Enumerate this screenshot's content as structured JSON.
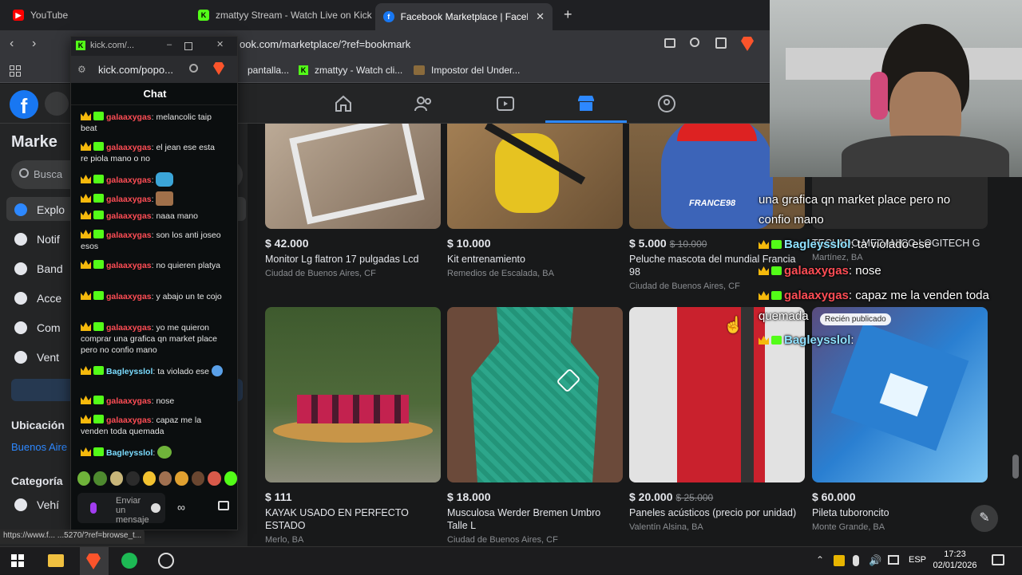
{
  "browser": {
    "tabs": [
      {
        "label": "YouTube",
        "icon": "youtube-icon"
      },
      {
        "label": "zmattyy Stream - Watch Live on Kick",
        "icon": "kick-icon"
      },
      {
        "label": "Facebook Marketplace | Faceboo",
        "icon": "facebook-icon",
        "active": true
      }
    ],
    "new_tab": "+",
    "close": "✕",
    "url": "ook.com/marketplace/?ref=bookmark",
    "bookmarks": [
      "pantalla...",
      "zmattyy - Watch cli...",
      "Impostor del Under..."
    ],
    "status_url": "https://www.f... ...5270/?ref=browse_t..."
  },
  "facebook": {
    "sidebar_title": "Marke",
    "search_placeholder": "Busca",
    "sidebar_items": [
      "Explo",
      "Notif",
      "Band",
      "Acce",
      "Com",
      "Vent"
    ],
    "location_heading": "Ubicación",
    "location_value": "Buenos Aire",
    "categories_heading": "Categoría",
    "category_first": "Vehí"
  },
  "listings": [
    {
      "price": "$ 42.000",
      "old_price": "",
      "title": "Monitor Lg flatron 17 pulgadas Lcd",
      "location": "Ciudad de Buenos Aires, CF",
      "colors": [
        "#b8a694",
        "#7e6a58"
      ]
    },
    {
      "price": "$ 10.000",
      "old_price": "",
      "title": "Kit entrenamiento",
      "location": "Remedios de Escalada, BA",
      "colors": [
        "#9a7a52",
        "#2b2b2b"
      ]
    },
    {
      "price": "$ 5.000",
      "old_price": "$ 10.000",
      "title": "Peluche mascota del mundial Francia 98",
      "location": "Ciudad de Buenos Aires, CF",
      "colors": [
        "#3c64b8",
        "#8d6f4a"
      ]
    },
    {
      "price": "",
      "old_price": "",
      "title": "TECLADO MECANICO LOGITECH G",
      "location": "Martínez, BA",
      "colors": [
        "#555",
        "#333"
      ]
    },
    {
      "price": "$ 111",
      "old_price": "",
      "title": "KAYAK USADO EN PERFECTO ESTADO",
      "location": "Merlo, BA",
      "colors": [
        "#3e5a2e",
        "#c89548"
      ]
    },
    {
      "price": "$ 18.000",
      "old_price": "",
      "title": "Musculosa Werder Bremen Umbro Talle L",
      "location": "Ciudad de Buenos Aires, CF",
      "colors": [
        "#2da68b",
        "#6b4a3a"
      ]
    },
    {
      "price": "$ 20.000",
      "old_price": "$ 25.000",
      "title": "Paneles acústicos (precio por unidad)",
      "location": "Valentín Alsina, BA",
      "colors": [
        "#c9212d",
        "#d8d8d8"
      ]
    },
    {
      "price": "$ 60.000",
      "old_price": "",
      "title": "Pileta tuboroncito",
      "location": "Monte Grande, BA",
      "colors": [
        "#2a7fd1",
        "#5a4c7e"
      ]
    }
  ],
  "recent_badge": "Recién publicado",
  "kick": {
    "window_title": "kick.com/...",
    "url": "kick.com/popo...",
    "chat_header": "Chat",
    "messages": [
      {
        "user": "galaaxygas",
        "text": ": melancolic taip beat"
      },
      {
        "user": "galaaxygas",
        "text": ": el jean ese esta re piola mano o no"
      },
      {
        "user": "galaaxygas",
        "text": ":"
      },
      {
        "user": "galaaxygas",
        "text": ":"
      },
      {
        "user": "galaaxygas",
        "text": ": naaa mano"
      },
      {
        "user": "galaaxygas",
        "text": ": son los anti joseo esos"
      },
      {
        "user": "galaaxygas",
        "text": ": no quieren platya"
      },
      {
        "user": "galaaxygas",
        "text": ": y abajo un te cojo"
      },
      {
        "user": "galaaxygas",
        "text": ": yo me quieron comprar una grafica qn market place pero no confio mano"
      },
      {
        "user": "Bagleysslol",
        "text": ": ta violado ese"
      },
      {
        "user": "galaaxygas",
        "text": ": nose"
      },
      {
        "user": "galaaxygas",
        "text": ": capaz me la venden toda quemada"
      },
      {
        "user": "Bagleysslol",
        "text": ":"
      }
    ],
    "input_placeholder": "Enviar un mensaje"
  },
  "overlay": {
    "line1": "una grafica qn market place pero no",
    "line1b": "confio mano",
    "line2_user": "Bagleysslol",
    "line2_text": ": ta violado ese",
    "line3_user": "galaaxygas",
    "line3_text": ": nose",
    "line4_user": "galaaxygas",
    "line4_text": ": capaz me la venden toda",
    "line4b": "quemada",
    "line5_user": "Bagleysslol",
    "line5_text": ":"
  },
  "taskbar": {
    "lang": "ESP",
    "time": "17:23",
    "date": "02/01/2026"
  }
}
